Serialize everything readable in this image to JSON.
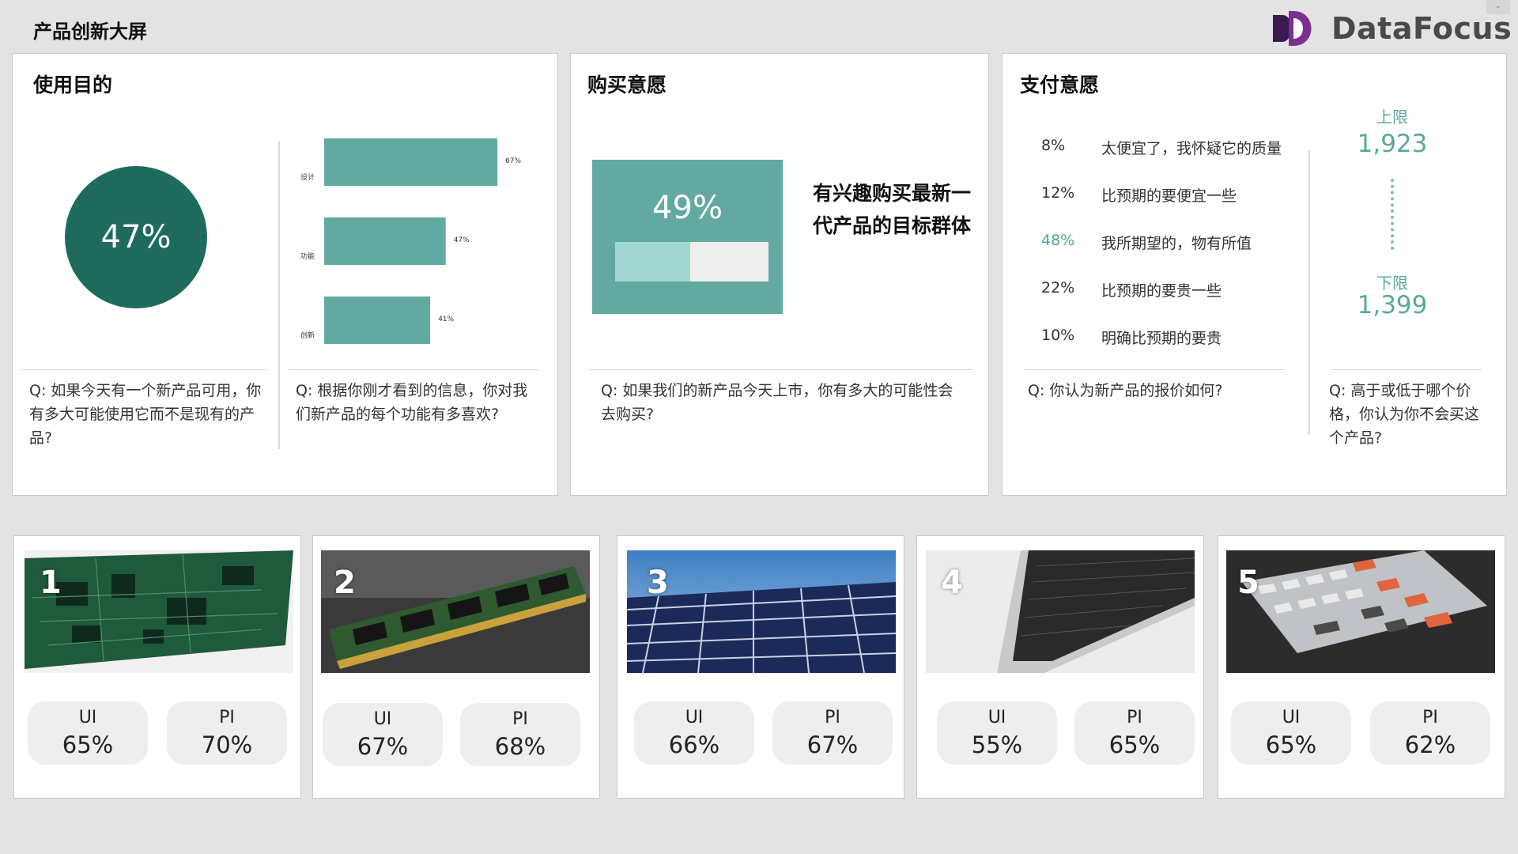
{
  "header": {
    "title": "产品创新大屏",
    "logo_text": "DataFocus",
    "logo_colors": {
      "dark": "#3b1a52",
      "accent": "#7b2f8f"
    },
    "toggle_icon": "chevron-down-icon"
  },
  "usage": {
    "title": "使用目的",
    "circle_value": "47%",
    "question_left": "Q: 如果今天有一个新产品可用，你有多大可能使用它而不是现有的产品?",
    "question_right": "Q: 根据你刚才看到的信息，你对我们新产品的每个功能有多喜欢?",
    "chart_data": {
      "type": "bar",
      "orientation": "horizontal",
      "categories": [
        "设计",
        "功能",
        "创新"
      ],
      "values": [
        67,
        47,
        41
      ],
      "value_labels": [
        "67%",
        "47%",
        "41%"
      ],
      "color": "#62aaa1",
      "xlim": [
        0,
        100
      ]
    }
  },
  "purchase": {
    "title": "购买意愿",
    "percent_label": "49%",
    "progress_fraction": 0.49,
    "description": "有兴趣购买最新一代产品的目标群体",
    "question": "Q: 如果我们的新产品今天上市，你有多大的可能性会去购买?"
  },
  "payment": {
    "title": "支付意愿",
    "rows": [
      {
        "pct": "8%",
        "text": "太便宜了，我怀疑它的质量",
        "highlight": false
      },
      {
        "pct": "12%",
        "text": "比预期的要便宜一些",
        "highlight": false
      },
      {
        "pct": "48%",
        "text": "我所期望的，物有所值",
        "highlight": true
      },
      {
        "pct": "22%",
        "text": "比预期的要贵一些",
        "highlight": false
      },
      {
        "pct": "10%",
        "text": "明确比预期的要贵",
        "highlight": false
      }
    ],
    "upper_label": "上限",
    "upper_value": "1,923",
    "lower_label": "下限",
    "lower_value": "1,399",
    "question_left": "Q: 你认为新产品的报价如何?",
    "question_right": "Q: 高于或低于哪个价格，你认为你不会买这个产品?"
  },
  "products": [
    {
      "num": "1",
      "image": "circuit-board",
      "ui_label": "UI",
      "ui": "65%",
      "pi_label": "PI",
      "pi": "70%"
    },
    {
      "num": "2",
      "image": "memory-module",
      "ui_label": "UI",
      "ui": "67%",
      "pi_label": "PI",
      "pi": "68%"
    },
    {
      "num": "3",
      "image": "solar-panel",
      "ui_label": "UI",
      "ui": "66%",
      "pi_label": "PI",
      "pi": "67%"
    },
    {
      "num": "4",
      "image": "laptop",
      "ui_label": "UI",
      "ui": "55%",
      "pi_label": "PI",
      "pi": "65%"
    },
    {
      "num": "5",
      "image": "keyboard",
      "ui_label": "UI",
      "ui": "65%",
      "pi_label": "PI",
      "pi": "62%"
    }
  ],
  "colors": {
    "teal_dark": "#1e6b5e",
    "teal": "#62aaa1",
    "teal_light": "#a2d8d1",
    "accent_text": "#5ba89d",
    "background": "#e3e3e3"
  }
}
